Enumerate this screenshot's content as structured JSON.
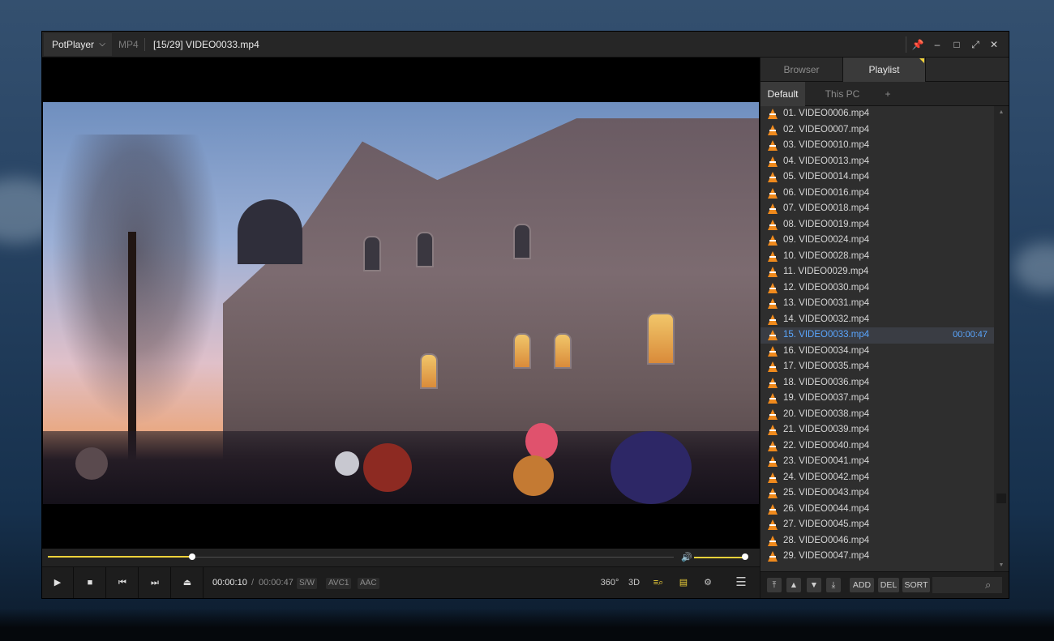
{
  "titlebar": {
    "app_name": "PotPlayer",
    "format": "MP4",
    "video_title": "[15/29] VIDEO0033.mp4",
    "window_controls": [
      "pin-icon",
      "minimize-icon",
      "maximize-icon",
      "fullscreen-icon",
      "close-icon"
    ]
  },
  "player": {
    "progress_fraction": 0.23,
    "volume_fraction": 1.0,
    "current_time": "00:00:10",
    "separator": "/",
    "total_time": "00:00:47",
    "badges": [
      "S/W",
      "AVC1",
      "AAC"
    ],
    "right_icons": [
      "360°",
      "3D"
    ]
  },
  "panel": {
    "tabs": [
      "Browser",
      "Playlist"
    ],
    "active_tab": "Playlist",
    "subtabs": [
      "Default",
      "This PC",
      "+"
    ],
    "items": [
      "01. VIDEO0006.mp4",
      "02. VIDEO0007.mp4",
      "03. VIDEO0010.mp4",
      "04. VIDEO0013.mp4",
      "05. VIDEO0014.mp4",
      "06. VIDEO0016.mp4",
      "07. VIDEO0018.mp4",
      "08. VIDEO0019.mp4",
      "09. VIDEO0024.mp4",
      "10. VIDEO0028.mp4",
      "11. VIDEO0029.mp4",
      "12. VIDEO0030.mp4",
      "13. VIDEO0031.mp4",
      "14. VIDEO0032.mp4",
      "15. VIDEO0033.mp4",
      "16. VIDEO0034.mp4",
      "17. VIDEO0035.mp4",
      "18. VIDEO0036.mp4",
      "19. VIDEO0037.mp4",
      "20. VIDEO0038.mp4",
      "21. VIDEO0039.mp4",
      "22. VIDEO0040.mp4",
      "23. VIDEO0041.mp4",
      "24. VIDEO0042.mp4",
      "25. VIDEO0043.mp4",
      "26. VIDEO0044.mp4",
      "27. VIDEO0045.mp4",
      "28. VIDEO0046.mp4",
      "29. VIDEO0047.mp4"
    ],
    "current_index": 14,
    "current_duration": "00:00:47",
    "footer_buttons": [
      "ADD",
      "DEL",
      "SORT"
    ],
    "search_placeholder": ""
  },
  "colors": {
    "accent_yellow": "#f0d23a",
    "current_item_blue": "#5aa6ff",
    "cone_orange": "#f08a1c"
  }
}
